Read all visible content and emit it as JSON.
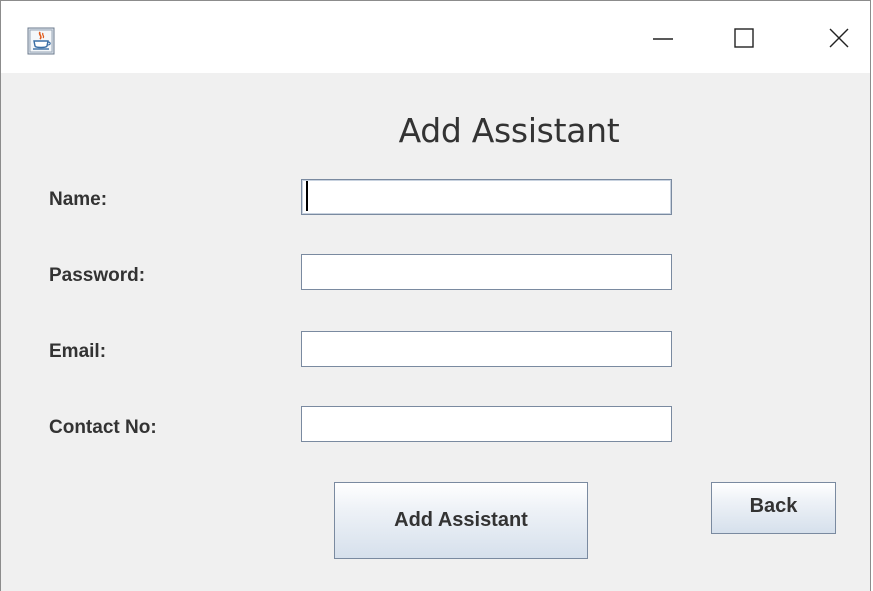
{
  "window": {
    "icons": {
      "app": "java-coffee-cup-icon",
      "minimize": "minimize-icon",
      "maximize": "maximize-icon",
      "close": "close-icon"
    }
  },
  "form": {
    "heading": "Add Assistant",
    "fields": [
      {
        "label": "Name:",
        "value": ""
      },
      {
        "label": "Password:",
        "value": ""
      },
      {
        "label": "Email:",
        "value": ""
      },
      {
        "label": "Contact No:",
        "value": ""
      }
    ],
    "submit_label": "Add Assistant",
    "back_label": "Back"
  },
  "colors": {
    "content_bg": "#f0f0f0",
    "titlebar_bg": "#ffffff",
    "field_border": "#7a8aa0",
    "text": "#333333",
    "button_gradient_bottom": "#d6e0ec"
  }
}
